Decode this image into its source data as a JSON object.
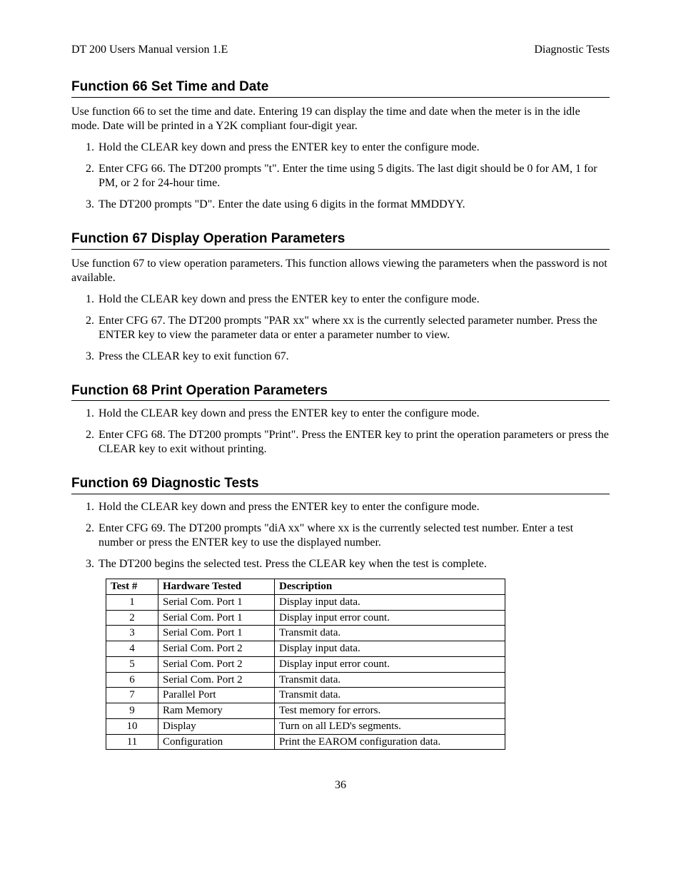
{
  "header": {
    "left": "DT 200 Users Manual version 1.E",
    "right": "Diagnostic Tests"
  },
  "sections": {
    "s66": {
      "title": "Function 66 Set Time and Date",
      "intro": "Use function 66 to set the time and date.  Entering 19 can display the time and date when the meter is in the idle mode. Date will be printed in a Y2K compliant four-digit year.",
      "steps": [
        "Hold the CLEAR key down and press the ENTER key to enter the configure mode.",
        "Enter CFG 66.  The DT200 prompts \"t\".  Enter the time using 5 digits.  The last digit should be 0 for AM, 1 for PM, or 2 for 24-hour time.",
        "The DT200 prompts \"D\".  Enter the date using 6 digits in the format MMDDYY."
      ]
    },
    "s67": {
      "title": "Function 67 Display Operation Parameters",
      "intro": "Use function 67 to view operation parameters.  This function allows viewing the parameters when the password is not available.",
      "steps": [
        "Hold the CLEAR key down and press the ENTER key to enter the configure mode.",
        "Enter CFG 67.  The DT200 prompts \"PAR xx\" where xx is the currently selected parameter number.  Press the ENTER key to view the parameter data or enter a parameter number to view.",
        "Press the CLEAR key to exit function 67."
      ]
    },
    "s68": {
      "title": "Function 68 Print Operation Parameters",
      "steps": [
        "Hold the CLEAR key down and press the ENTER key to enter the configure mode.",
        "Enter CFG 68.  The DT200 prompts \"Print\".  Press the ENTER key to print the operation parameters or press the CLEAR key to exit without printing."
      ]
    },
    "s69": {
      "title": "Function 69 Diagnostic Tests",
      "steps": [
        "Hold the CLEAR key down and press the ENTER key to enter the configure mode.",
        "Enter CFG 69.  The DT200 prompts \"diA xx\" where xx is the currently selected test number.   Enter a test number or press the ENTER key to use the displayed number.",
        "The DT200 begins the selected test.  Press the CLEAR key when the test is complete."
      ]
    }
  },
  "table": {
    "headers": {
      "c1": "Test  #",
      "c2": "Hardware Tested",
      "c3": "Description"
    },
    "rows": [
      {
        "num": "1",
        "hw": "Serial Com. Port 1",
        "desc": "Display input data."
      },
      {
        "num": "2",
        "hw": "Serial Com. Port 1",
        "desc": "Display input error count."
      },
      {
        "num": "3",
        "hw": "Serial Com. Port 1",
        "desc": "Transmit data."
      },
      {
        "num": "4",
        "hw": "Serial Com. Port 2",
        "desc": "Display input data."
      },
      {
        "num": "5",
        "hw": "Serial Com. Port 2",
        "desc": "Display input error count."
      },
      {
        "num": "6",
        "hw": "Serial Com. Port 2",
        "desc": "Transmit data."
      },
      {
        "num": "7",
        "hw": "Parallel Port",
        "desc": "Transmit data."
      },
      {
        "num": "9",
        "hw": "Ram Memory",
        "desc": "Test memory for errors."
      },
      {
        "num": "10",
        "hw": "Display",
        "desc": "Turn on all LED's segments."
      },
      {
        "num": "11",
        "hw": "Configuration",
        "desc": "Print the EAROM configuration data."
      }
    ]
  },
  "page_number": "36"
}
